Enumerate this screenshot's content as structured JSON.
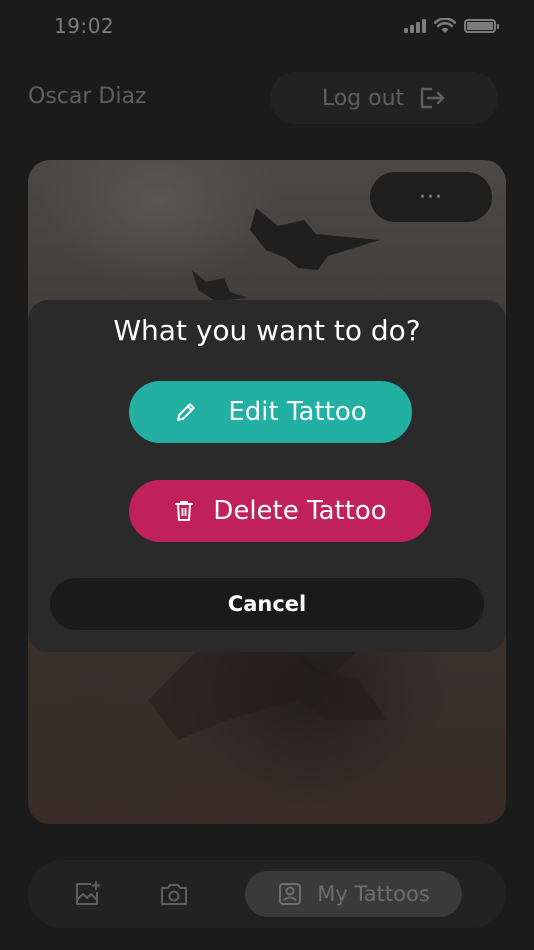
{
  "status_bar": {
    "time": "19:02",
    "icons": [
      "signal-icon",
      "wifi-icon",
      "battery-icon"
    ]
  },
  "header": {
    "user_name": "Oscar Diaz",
    "logout_label": "Log out",
    "logout_icon": "logout-icon"
  },
  "photo_card": {
    "more_label": "···",
    "more_icon": "more-icon"
  },
  "action_dialog": {
    "title": "What you want to do?",
    "edit_label": "Edit Tattoo",
    "edit_icon": "pencil-icon",
    "delete_label": "Delete Tattoo",
    "delete_icon": "trash-icon",
    "cancel_label": "Cancel"
  },
  "bottom_nav": {
    "items": [
      {
        "icon": "gallery-add-icon",
        "label": ""
      },
      {
        "icon": "camera-icon",
        "label": ""
      },
      {
        "icon": "portrait-icon",
        "label": "My Tattoos",
        "active": true
      }
    ]
  },
  "colors": {
    "background": "#1b1b1b",
    "edit_accent": "#22b0a3",
    "delete_accent": "#c02158",
    "dialog_bg": "#2a2a2a",
    "muted_text": "#5f5f5f"
  }
}
